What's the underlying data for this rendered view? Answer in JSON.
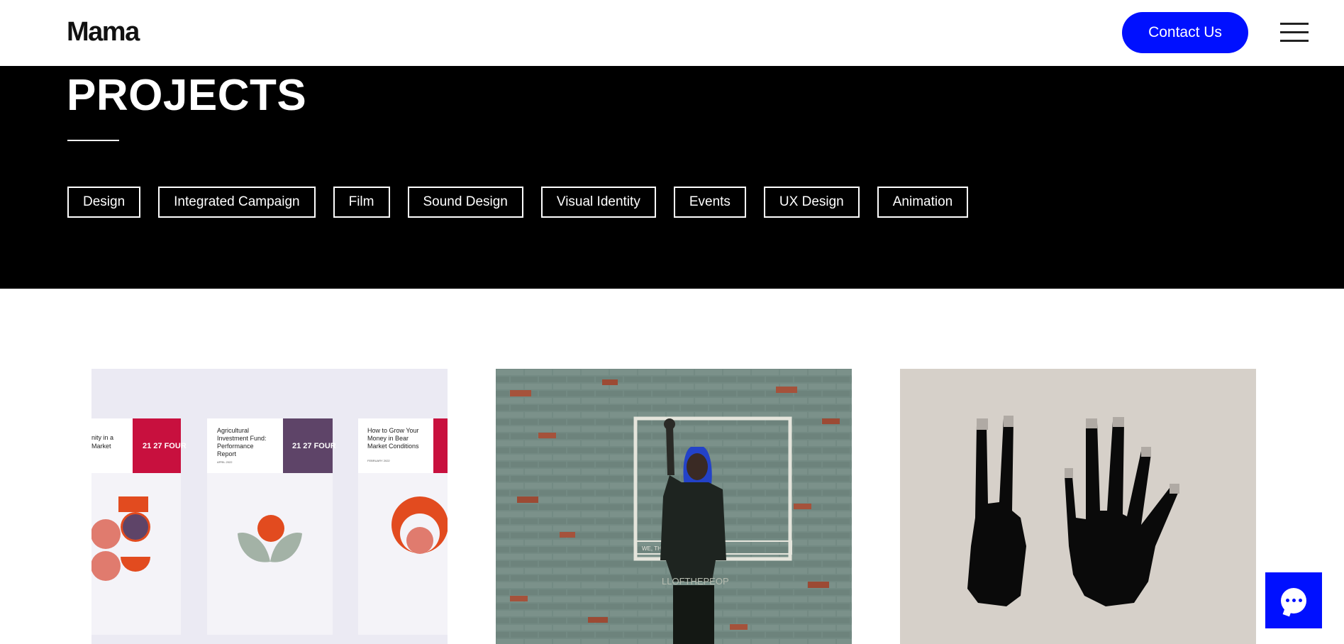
{
  "header": {
    "logo": "Mama",
    "contact_label": "Contact Us"
  },
  "hero": {
    "title": "PROJECTS",
    "tags": [
      "Design",
      "Integrated Campaign",
      "Film",
      "Sound Design",
      "Visual Identity",
      "Events",
      "UX Design",
      "Animation"
    ]
  },
  "cards": {
    "card1": {
      "books": [
        {
          "title_lines": [
            "nity in a",
            "Market"
          ],
          "brand": "21 27 FOUR"
        },
        {
          "title_lines": [
            "Agricultural",
            "Investment Fund:",
            "Performance",
            "Report"
          ],
          "date": "APRIL 2022",
          "brand": "21 27 FOUR"
        },
        {
          "title_lines": [
            "How to Grow Your",
            "Money in Bear",
            "Market Conditions"
          ],
          "date": "FEBRUARY 2022"
        }
      ]
    },
    "card2": {
      "sign_text": "WE, THE PE",
      "shirt_text": "LLOFTHEPEOP"
    }
  },
  "colors": {
    "accent": "#0010ff",
    "hero_bg": "#000000",
    "book_red": "#c8103e",
    "book_purple": "#5e4468",
    "shape_coral": "#e07b6e",
    "shape_orange": "#e24b1f",
    "shape_green": "#a3b2a6"
  },
  "icons": {
    "menu": "hamburger-menu-icon",
    "chat": "chat-bubble-icon"
  }
}
